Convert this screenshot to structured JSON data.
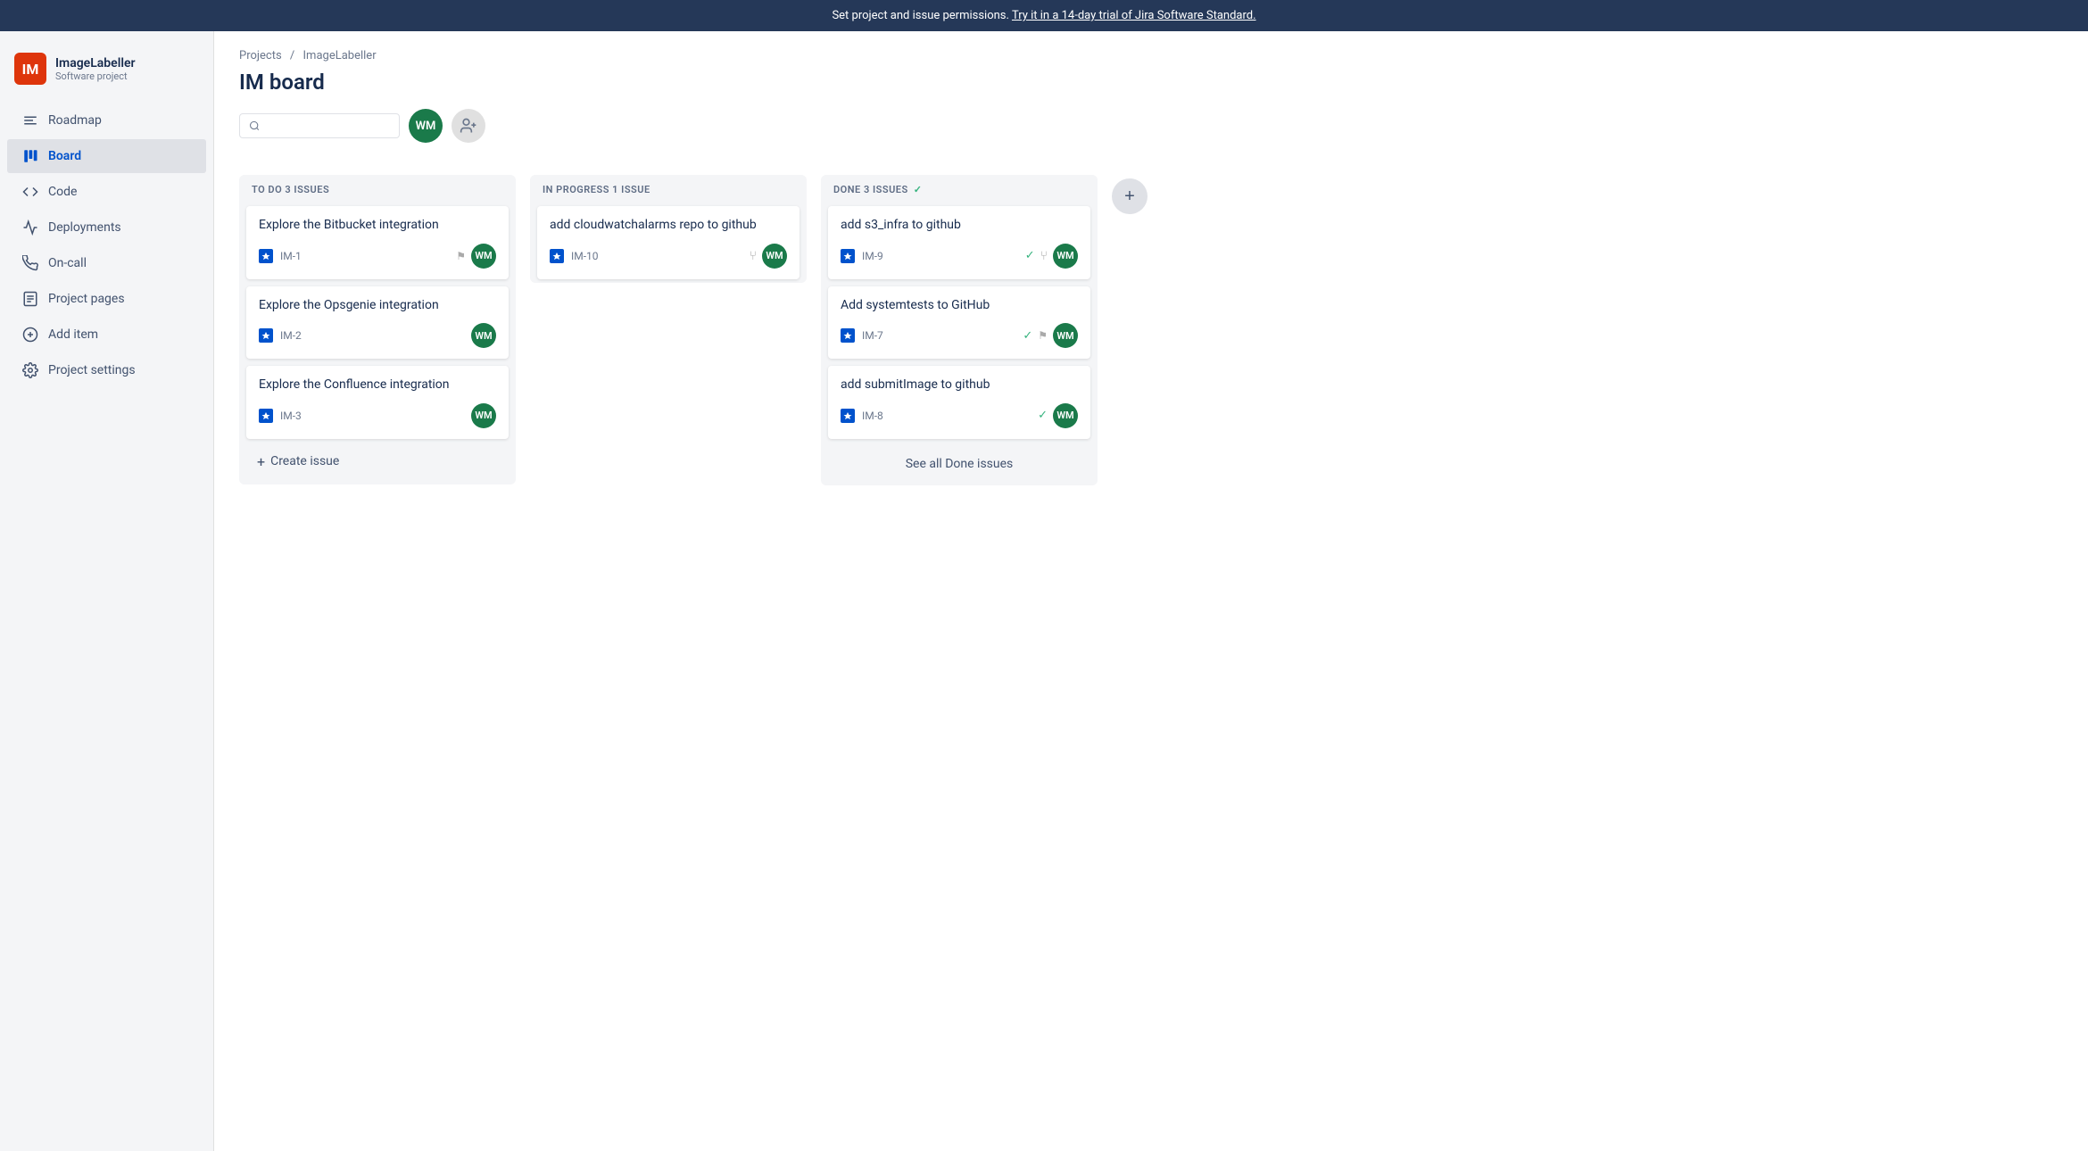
{
  "banner": {
    "text": "Set project and issue permissions.",
    "link_text": "Try it in a 14-day trial of Jira Software Standard."
  },
  "sidebar": {
    "project_icon": "IM",
    "project_name": "ImageLabeller",
    "project_type": "Software project",
    "nav_items": [
      {
        "id": "roadmap",
        "label": "Roadmap",
        "icon": "roadmap",
        "active": false
      },
      {
        "id": "board",
        "label": "Board",
        "icon": "board",
        "active": true
      },
      {
        "id": "code",
        "label": "Code",
        "icon": "code",
        "active": false
      },
      {
        "id": "deployments",
        "label": "Deployments",
        "icon": "deployments",
        "active": false
      },
      {
        "id": "oncall",
        "label": "On-call",
        "icon": "oncall",
        "active": false
      },
      {
        "id": "project-pages",
        "label": "Project pages",
        "icon": "pages",
        "active": false
      },
      {
        "id": "add-item",
        "label": "Add item",
        "icon": "add",
        "active": false
      },
      {
        "id": "project-settings",
        "label": "Project settings",
        "icon": "settings",
        "active": false
      }
    ]
  },
  "breadcrumb": {
    "projects_label": "Projects",
    "separator": "/",
    "project_label": "ImageLabeller"
  },
  "page": {
    "title": "IM board"
  },
  "toolbar": {
    "search_placeholder": "",
    "avatar_initials": "WM",
    "add_people_title": "Add people"
  },
  "board": {
    "columns": [
      {
        "id": "todo",
        "header": "TO DO 3 ISSUES",
        "cards": [
          {
            "id": "IM-1",
            "title": "Explore the Bitbucket integration",
            "flag": true,
            "branch": false,
            "green_check": false,
            "avatar": "WM"
          },
          {
            "id": "IM-2",
            "title": "Explore the Opsgenie integration",
            "flag": false,
            "branch": false,
            "green_check": false,
            "avatar": "WM"
          },
          {
            "id": "IM-3",
            "title": "Explore the Confluence integration",
            "flag": false,
            "branch": false,
            "green_check": false,
            "avatar": "WM"
          }
        ],
        "footer": "Create issue",
        "see_all": false
      },
      {
        "id": "inprogress",
        "header": "IN PROGRESS 1 ISSUE",
        "cards": [
          {
            "id": "IM-10",
            "title": "add cloudwatchalarms repo to github",
            "flag": false,
            "branch": true,
            "green_check": false,
            "avatar": "WM"
          }
        ],
        "footer": null,
        "see_all": false
      },
      {
        "id": "done",
        "header": "DONE 3 ISSUES",
        "done": true,
        "cards": [
          {
            "id": "IM-9",
            "title": "add s3_infra to github",
            "flag": false,
            "branch": true,
            "green_check": true,
            "avatar": "WM"
          },
          {
            "id": "IM-7",
            "title": "Add systemtests to GitHub",
            "flag": true,
            "branch": false,
            "green_check": true,
            "avatar": "WM"
          },
          {
            "id": "IM-8",
            "title": "add submitImage to github",
            "flag": false,
            "branch": false,
            "green_check": true,
            "avatar": "WM"
          }
        ],
        "footer": null,
        "see_all": "See all Done issues"
      }
    ]
  }
}
